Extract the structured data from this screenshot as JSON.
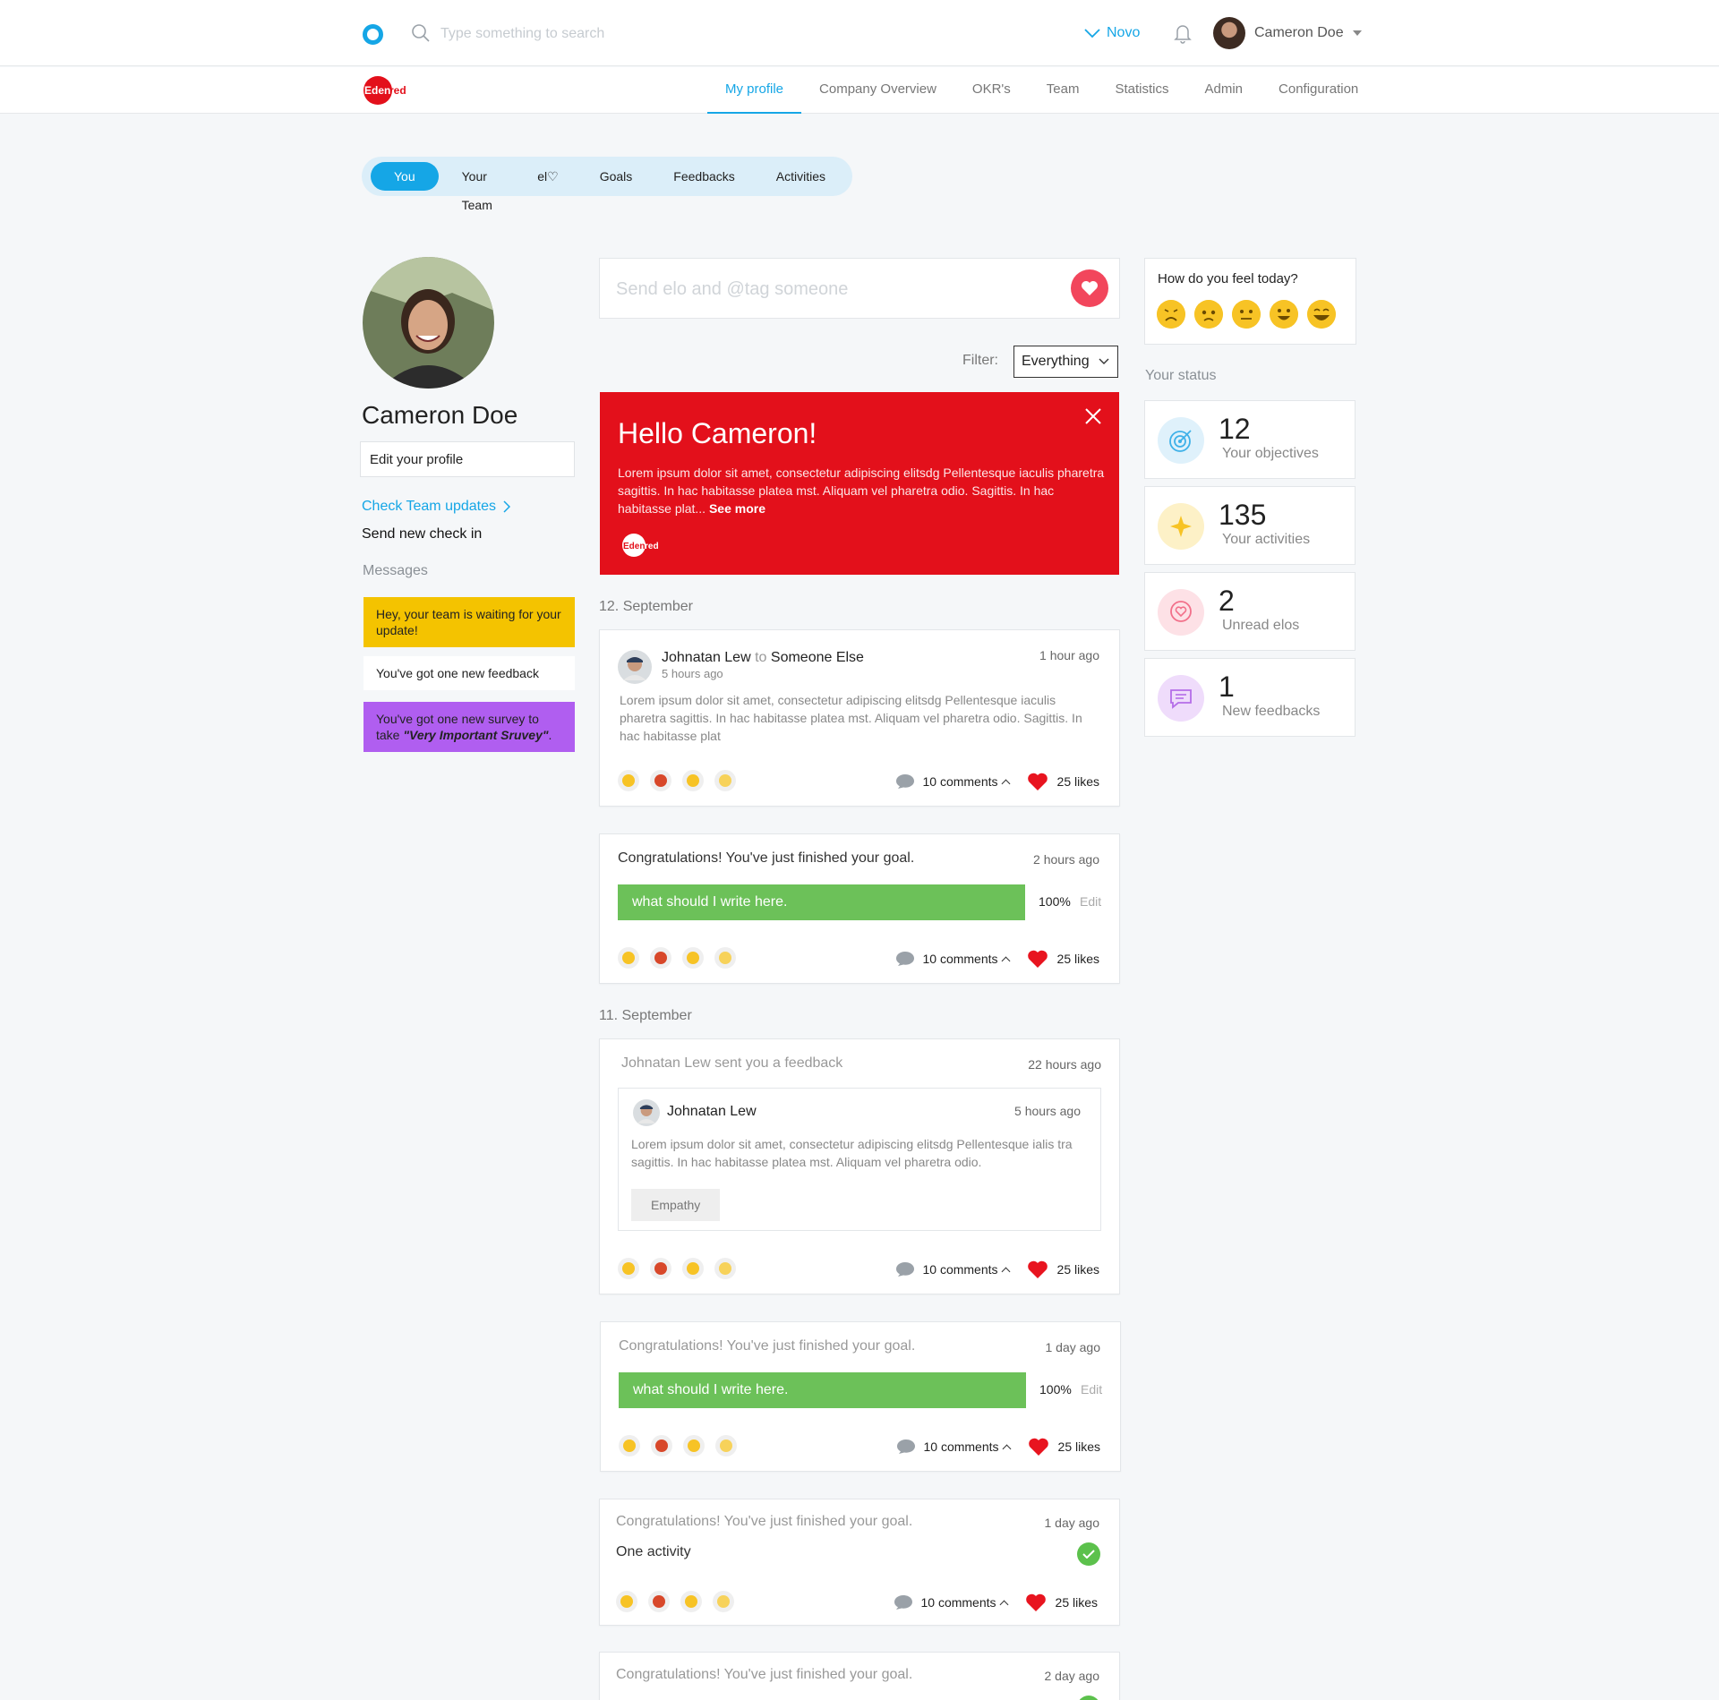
{
  "topbar": {
    "search_placeholder": "Type something to search",
    "workspace": "Novo",
    "user_name": "Cameron Doe"
  },
  "nav": [
    "My profile",
    "Company Overview",
    "OKR's",
    "Team",
    "Statistics",
    "Admin",
    "Configuration"
  ],
  "tabs": [
    "You",
    "Your Team",
    "el♡",
    "Goals",
    "Feedbacks",
    "Activities"
  ],
  "profile": {
    "name": "Cameron Doe",
    "edit_label": "Edit your profile",
    "check_team": "Check Team updates",
    "send_checkin": "Send new check in",
    "messages_title": "Messages"
  },
  "messages": {
    "m1": "Hey, your team is waiting for your update!",
    "m2": "You've got one new feedback",
    "m3_prefix": "You've got one new survey to take ",
    "m3_emph": "\"Very Important Sruvey\"",
    "m3_suffix": "."
  },
  "composer": {
    "placeholder": "Send elo and @tag someone"
  },
  "filter": {
    "label": "Filter:",
    "value": "Everything"
  },
  "hello": {
    "title": "Hello Cameron!",
    "body": "Lorem ipsum dolor sit amet, consectetur adipiscing elitsdg Pellentesque iaculis pharetra sagittis. In hac habitasse platea mst. Aliquam vel pharetra odio. Sagittis. In hac habitasse plat... ",
    "see_more": "See more",
    "logo_text": "Edenred"
  },
  "feed": {
    "date1": "12. September",
    "date2": "11. September",
    "post1": {
      "author": "Johnatan Lew",
      "to_word": "to",
      "recipient": "Someone Else",
      "sub_time": "5 hours ago",
      "time": "1 hour ago",
      "body": "Lorem ipsum dolor sit amet, consectetur adipiscing elitsdg Pellentesque iaculis pharetra sagittis. In hac habitasse platea mst. Aliquam vel pharetra odio. Sagittis. In hac habitasse plat"
    },
    "goal1": {
      "title": "Congratulations! You've just finished your goal.",
      "time": "2 hours ago",
      "bar_text": "what should I write here.",
      "pct": "100%",
      "edit": "Edit",
      "progress": 1.0
    },
    "feedback": {
      "title": "Johnatan Lew sent you a feedback",
      "time": "22 hours ago",
      "author": "Johnatan Lew",
      "inner_time": "5 hours ago",
      "body": "Lorem ipsum dolor sit amet, consectetur adipiscing elitsdg Pellentesque ialis tra sagittis. In hac habitasse platea mst. Aliquam vel pharetra odio.",
      "tag": "Empathy"
    },
    "goal2": {
      "title": "Congratulations! You've just finished your goal.",
      "time": "1 day ago",
      "bar_text": "what should I write here.",
      "pct": "100%",
      "edit": "Edit",
      "progress": 1.0
    },
    "goal3": {
      "title": "Congratulations! You've just finished your goal.",
      "time": "1 day ago",
      "activity": "One activity"
    },
    "goal4": {
      "title": "Congratulations! You've just finished your goal.",
      "time": "2 day ago"
    },
    "comments": "10 comments",
    "likes": "25 likes"
  },
  "mood": {
    "title": "How do you feel today?"
  },
  "status": {
    "title": "Your status",
    "items": [
      {
        "num": "12",
        "label": "Your objectives",
        "icon": "target-icon",
        "color": "#dff1fb"
      },
      {
        "num": "135",
        "label": "Your activities",
        "icon": "sparkle-icon",
        "color": "#fdf1c7"
      },
      {
        "num": "2",
        "label": "Unread elos",
        "icon": "heart-chat-icon",
        "color": "#fde1e6"
      },
      {
        "num": "1",
        "label": "New feedbacks",
        "icon": "feedback-icon",
        "color": "#efdcfb"
      }
    ]
  },
  "colors": {
    "accent": "#15a6e6",
    "hello_bg": "#e3101b",
    "progress": "#6cc159",
    "like": "#e8141f"
  }
}
